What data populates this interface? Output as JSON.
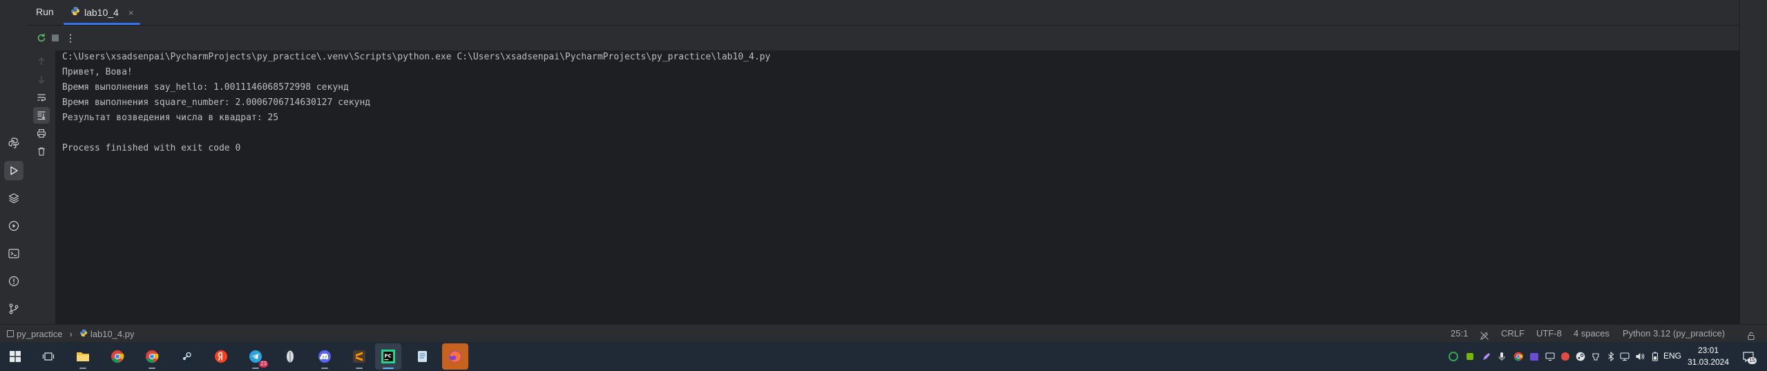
{
  "header": {
    "panel_title": "Run",
    "tab_label": "lab10_4",
    "tab_close": "×"
  },
  "toolbar": {
    "more_label": "⋮"
  },
  "console": {
    "lines": [
      "C:\\Users\\xsadsenpai\\PycharmProjects\\py_practice\\.venv\\Scripts\\python.exe C:\\Users\\xsadsenpai\\PycharmProjects\\py_practice\\lab10_4.py",
      "Привет, Вова!",
      "Время выполнения say_hello: 1.0011146068572998 секунд",
      "Время выполнения square_number: 2.0006706714630127 секунд",
      "Результат возведения числа в квадрат: 25",
      "",
      "Process finished with exit code 0"
    ]
  },
  "status_bar": {
    "project": "py_practice",
    "file": "lab10_4.py",
    "position": "25:1",
    "line_ending": "CRLF",
    "encoding": "UTF-8",
    "indent": "4 spaces",
    "interpreter": "Python 3.12 (py_practice)"
  },
  "taskbar": {
    "language": "ENG",
    "time": "23:01",
    "date": "31.03.2024",
    "notification_count": "15",
    "telegram_badge": "23"
  },
  "colors": {
    "accent": "#3574f0",
    "panel": "#2b2d30",
    "editor_bg": "#1e1f22",
    "taskbar": "#202a36"
  }
}
